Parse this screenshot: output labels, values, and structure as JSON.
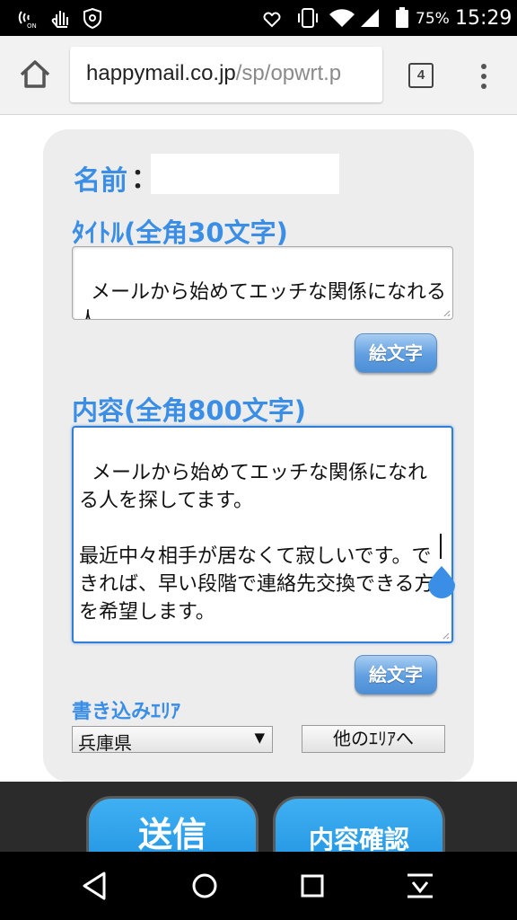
{
  "status_bar": {
    "battery_percent": "75%",
    "time": "15:29",
    "icons": [
      "nfc-icon",
      "hand-icon",
      "shield-icon",
      "heart-signal-icon",
      "vibrate-icon",
      "wifi-icon",
      "cell-signal-icon",
      "battery-icon"
    ]
  },
  "browser": {
    "url_host": "happymail.co.jp",
    "url_path": "/sp/opwrt.p",
    "tab_count": "4"
  },
  "form": {
    "name_label": "名前",
    "name_colon": "：",
    "name_value": "",
    "title_label": "ﾀｲﾄﾙ(全角30文字)",
    "title_value": "メールから始めてエッチな関係になれる人",
    "emoji_button_1": "絵文字",
    "content_label": "内容(全角800文字)",
    "content_value": "メールから始めてエッチな関係になれる人を探してます。\n\n最近中々相手が居なくて寂しいです。できれば、早い段階で連絡先交換できる方を希望します。",
    "emoji_button_2": "絵文字",
    "area_label": "書き込みｴﾘｱ",
    "area_selected": "兵庫県",
    "other_area_button": "他のｴﾘｱへ"
  },
  "actions": {
    "send_label": "送信",
    "confirm_label": "内容確認"
  },
  "colors": {
    "accent": "#3a8ee6",
    "button_blue": "#1c8fe0",
    "card_bg": "#ededed"
  }
}
